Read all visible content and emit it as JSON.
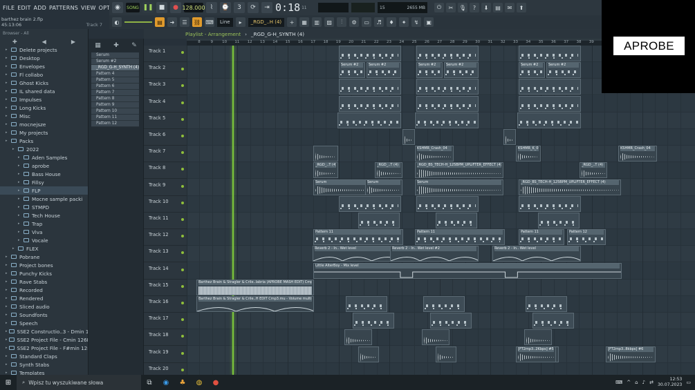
{
  "menu": [
    "FILE",
    "EDIT",
    "ADD",
    "PATTERNS",
    "VIEW",
    "OPTIONS",
    "TOOLS",
    "HELP"
  ],
  "song": {
    "file": "barthez brain 2.flp",
    "time": "45:13:06",
    "track": "Track 7"
  },
  "transport": {
    "mode": "SONG",
    "tempo": "128.000",
    "time": "0:18",
    "time_sub": "11",
    "ms": "M:S:CS",
    "cpu": "15",
    "mem": "2655 MB"
  },
  "toolbar2": {
    "snap": "Line",
    "pattern": "_RGD_..H (4)"
  },
  "browser": {
    "header": "Browser - All",
    "items": [
      {
        "label": "Delete projects",
        "lvl": 0
      },
      {
        "label": "Desktop",
        "lvl": 0
      },
      {
        "label": "Envelopes",
        "lvl": 0
      },
      {
        "label": "Fl collabo",
        "lvl": 0
      },
      {
        "label": "Ghost Kicks",
        "lvl": 0
      },
      {
        "label": "IL shared data",
        "lvl": 0
      },
      {
        "label": "Impulses",
        "lvl": 0
      },
      {
        "label": "Long Kicks",
        "lvl": 0
      },
      {
        "label": "Misc",
        "lvl": 0
      },
      {
        "label": "mocnejsze",
        "lvl": 0
      },
      {
        "label": "My projects",
        "lvl": 0
      },
      {
        "label": "Packs",
        "lvl": 0
      },
      {
        "label": "2022",
        "lvl": 1
      },
      {
        "label": "Aden Samples",
        "lvl": 2
      },
      {
        "label": "aprobe",
        "lvl": 2
      },
      {
        "label": "Bass House",
        "lvl": 2
      },
      {
        "label": "Fillsy",
        "lvl": 2
      },
      {
        "label": "FLP",
        "lvl": 2,
        "sel": true
      },
      {
        "label": "Mocne sample packi",
        "lvl": 2
      },
      {
        "label": "STMPD",
        "lvl": 2
      },
      {
        "label": "Tech House",
        "lvl": 2
      },
      {
        "label": "Trap",
        "lvl": 2
      },
      {
        "label": "Viva",
        "lvl": 2
      },
      {
        "label": "Vocale",
        "lvl": 2
      },
      {
        "label": "FLEX",
        "lvl": 1
      },
      {
        "label": "Pobrane",
        "lvl": 0
      },
      {
        "label": "Project bones",
        "lvl": 0
      },
      {
        "label": "Punchy Kicks",
        "lvl": 0
      },
      {
        "label": "Rave Stabs",
        "lvl": 0
      },
      {
        "label": "Recorded",
        "lvl": 0
      },
      {
        "label": "Rendered",
        "lvl": 0
      },
      {
        "label": "Sliced audio",
        "lvl": 0
      },
      {
        "label": "Soundfonts",
        "lvl": 0
      },
      {
        "label": "Speech",
        "lvl": 0
      },
      {
        "label": "SSE2 Constructio..3 - Dmin 128BPM",
        "lvl": 0
      },
      {
        "label": "SSE2 Project File - Cmin 126BPM",
        "lvl": 0
      },
      {
        "label": "SSE2 Project File - F#min 128BPM",
        "lvl": 0
      },
      {
        "label": "Standard Claps",
        "lvl": 0
      },
      {
        "label": "Synth Stabs",
        "lvl": 0
      },
      {
        "label": "Templates",
        "lvl": 0
      }
    ]
  },
  "picker": [
    "Serum",
    "Serum #2",
    "_RGD_G-H_SYNTH (4)",
    "Pattern 4",
    "Pattern 5",
    "Pattern 6",
    "Pattern 7",
    "Pattern 8",
    "Pattern 9",
    "Pattern 10",
    "Pattern 11",
    "Pattern 12"
  ],
  "playlist": {
    "title": "Playlist - Arrangement",
    "sep": "›",
    "pattern": "_RGD_G-H_SYNTH (4)"
  },
  "ruler": [
    "8",
    "9",
    "10",
    "11",
    "12",
    "13",
    "14",
    "15",
    "16",
    "17",
    "18",
    "19",
    "20",
    "21",
    "22",
    "23",
    "24",
    "25",
    "26",
    "27",
    "28",
    "29",
    "30",
    "31",
    "32",
    "33",
    "34",
    "35",
    "36",
    "37",
    "38",
    "39"
  ],
  "tracks": [
    "Track 1",
    "Track 2",
    "Track 3",
    "Track 4",
    "Track 5",
    "Track 6",
    "Track 7",
    "Track 8",
    "Track 9",
    "Track 10",
    "Track 11",
    "Track 12",
    "Track 13",
    "Track 14",
    "Track 15",
    "Track 16",
    "Track 17",
    "Track 18",
    "Track 19",
    "Track 20"
  ],
  "clips": {
    "serum2": "Serum #2",
    "crash": "KSHMR_Crash_04",
    "kick": "KSHMR_K_06",
    "rgd": "_RGD_..T (4)",
    "bs": "_RGD_BS_TECH-H_125BPM_UPLIFTER_EFFECT (4)",
    "serum": "Serum",
    "pat11": "Pattern 11",
    "pat12": "Pattern 12",
    "reverb": "Reverb 2 - In.. Wet level",
    "reverb2": "Reverb 2 - In.. Wet level #2",
    "alter": "Little AlterBoy - Mix level",
    "vocal": "Barthez Brain & Stragler & Crile..labria (APROBE MASH EDIT) Cmp3.mp",
    "vocal2": "Barthez Brain & Stragler & Crile..H EDIT Cmp3.mu - Volume multiplier",
    "ft": "[FT2mp3..2Kbps] #5",
    "ft2": "[FT2mp3..8kbps] #6"
  },
  "logo": "APROBE",
  "taskbar": {
    "search": "Wpisz tu wyszukiwane słowa",
    "time": "12:53",
    "date": "30.07.2023"
  }
}
